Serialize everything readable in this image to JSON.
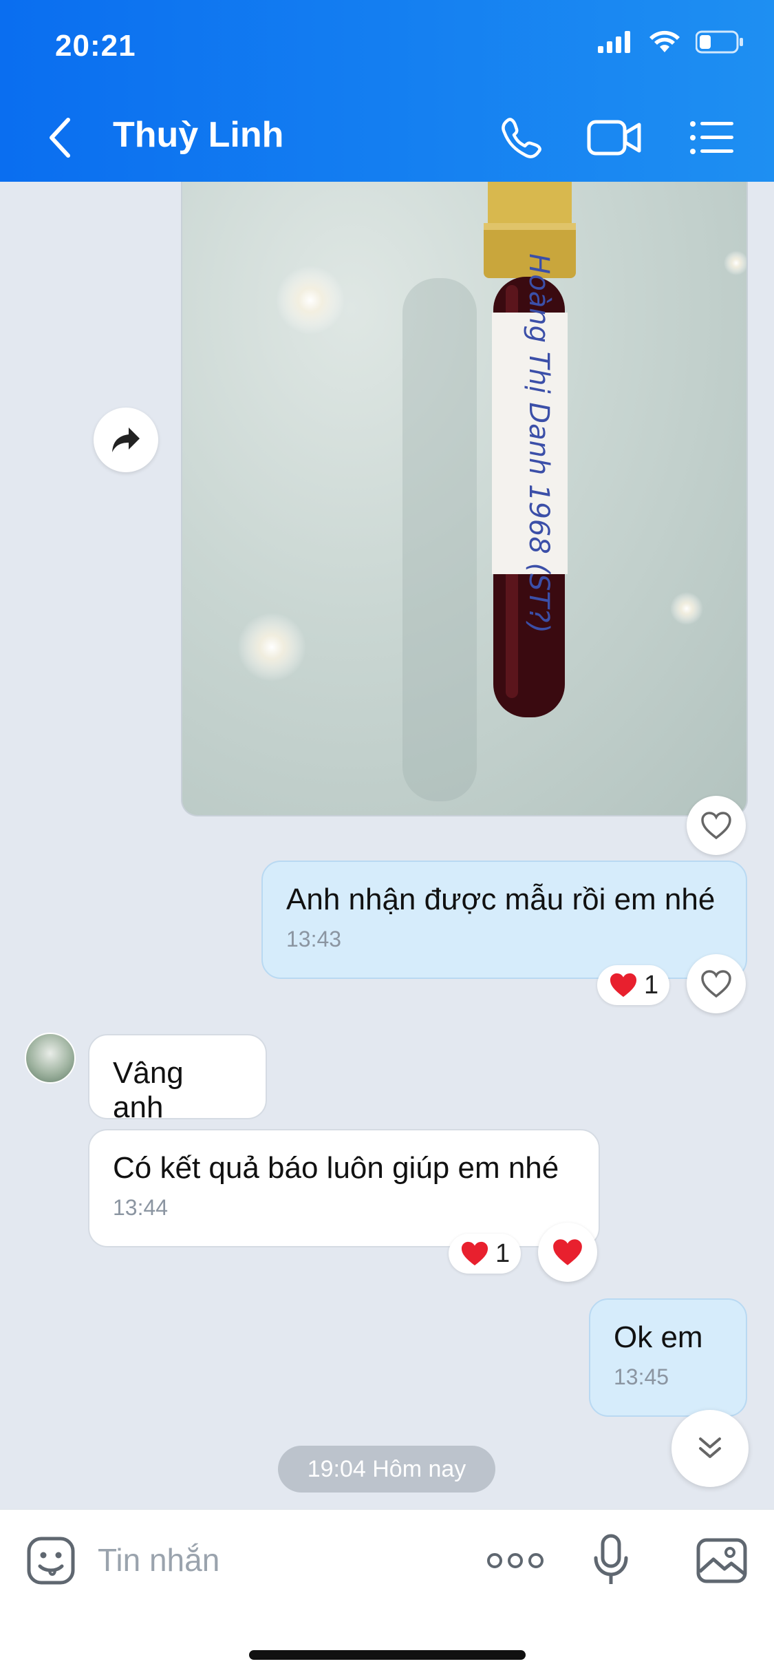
{
  "status_bar": {
    "time": "20:21",
    "icons": [
      "signal-icon",
      "wifi-icon",
      "battery-icon"
    ]
  },
  "header": {
    "back_icon": "chevron-left-icon",
    "title": "Thuỳ Linh",
    "actions": [
      "phone-icon",
      "video-call-icon",
      "list-menu-icon"
    ]
  },
  "photo_message": {
    "label_text": "Hoàng Thị Danh 1968 (ST?)"
  },
  "messages": [
    {
      "direction": "out",
      "text": "Anh nhận được mẫu rồi em nhé",
      "time": "13:43",
      "reaction_count": "1"
    },
    {
      "direction": "in",
      "text": "Vâng anh"
    },
    {
      "direction": "in",
      "text": "Có kết quả báo luôn giúp em nhé",
      "time": "13:44",
      "reaction_count": "1"
    },
    {
      "direction": "out",
      "text": "Ok em",
      "time": "13:45"
    }
  ],
  "date_separator": "19:04 Hôm nay",
  "input": {
    "placeholder": "Tin nhắn"
  },
  "colors": {
    "header": "#0a6ef0",
    "outgoing_bubble": "#d6ecfb",
    "heart": "#e8202e"
  }
}
